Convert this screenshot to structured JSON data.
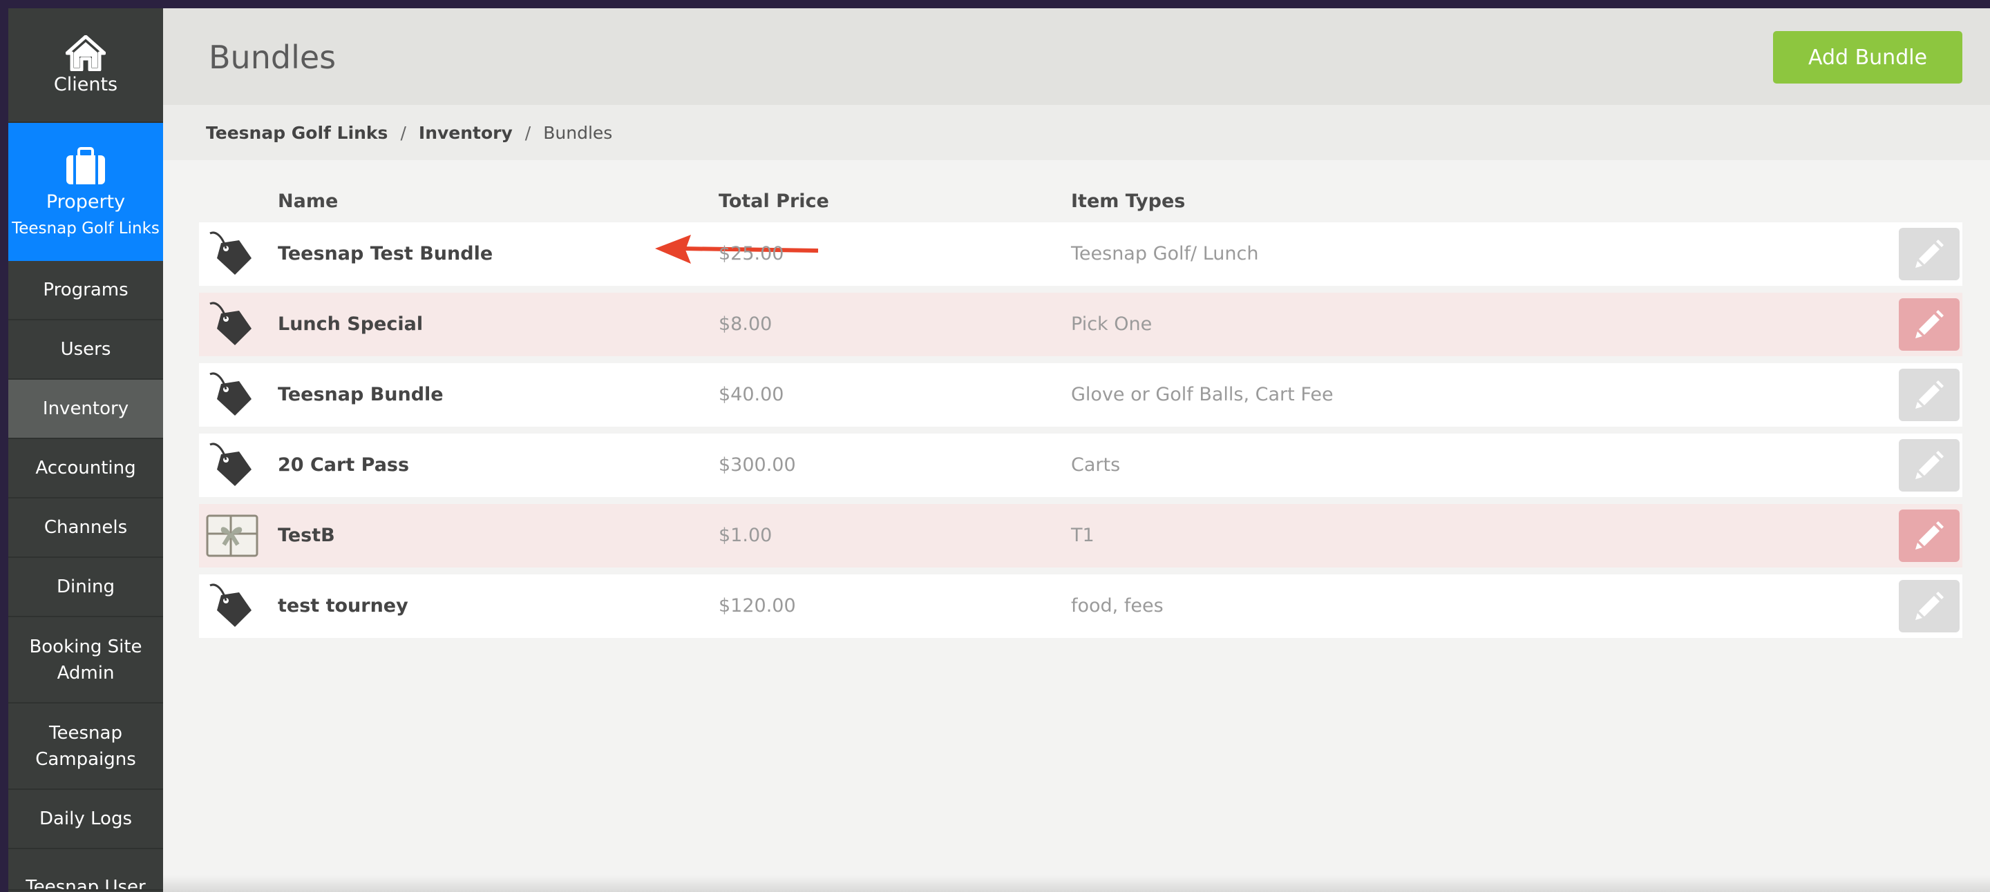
{
  "colors": {
    "sidebar_bg": "#3a3d3b",
    "sidebar_active": "#5a5d5b",
    "property_blue": "#0a84ff",
    "add_button_green": "#8dc63f",
    "warn_row": "#f7e9e8",
    "warn_edit": "#e8a8ab",
    "annotation_arrow": "#e8432a"
  },
  "sidebar": {
    "clients": {
      "label": "Clients",
      "icon": "home-icon"
    },
    "property": {
      "label": "Property",
      "sub": "Teesnap Golf Links",
      "icon": "briefcase-icon"
    },
    "items": [
      {
        "label": "Programs"
      },
      {
        "label": "Users"
      },
      {
        "label": "Inventory",
        "active": true
      },
      {
        "label": "Accounting"
      },
      {
        "label": "Channels"
      },
      {
        "label": "Dining"
      },
      {
        "label": "Booking Site Admin"
      },
      {
        "label": "Teesnap Campaigns"
      },
      {
        "label": "Daily Logs"
      },
      {
        "label": "Teesnap User"
      }
    ]
  },
  "header": {
    "title": "Bundles",
    "add_button": "Add Bundle"
  },
  "breadcrumb": {
    "items": [
      "Teesnap Golf Links",
      "Inventory",
      "Bundles"
    ],
    "separator": "/"
  },
  "table": {
    "columns": {
      "name": "Name",
      "price": "Total Price",
      "types": "Item Types"
    },
    "rows": [
      {
        "icon": "tag-icon",
        "name": "Teesnap Test Bundle",
        "price": "$25.00",
        "types": "Teesnap Golf/ Lunch",
        "warn": false
      },
      {
        "icon": "tag-icon",
        "name": "Lunch Special",
        "price": "$8.00",
        "types": "Pick One",
        "warn": true
      },
      {
        "icon": "tag-icon",
        "name": "Teesnap Bundle",
        "price": "$40.00",
        "types": "Glove or Golf Balls, Cart Fee",
        "warn": false
      },
      {
        "icon": "tag-icon",
        "name": "20 Cart Pass",
        "price": "$300.00",
        "types": "Carts",
        "warn": false
      },
      {
        "icon": "gift-card-icon",
        "name": "TestB",
        "price": "$1.00",
        "types": "T1",
        "warn": true
      },
      {
        "icon": "tag-icon",
        "name": "test tourney",
        "price": "$120.00",
        "types": "food, fees",
        "warn": false
      }
    ]
  }
}
